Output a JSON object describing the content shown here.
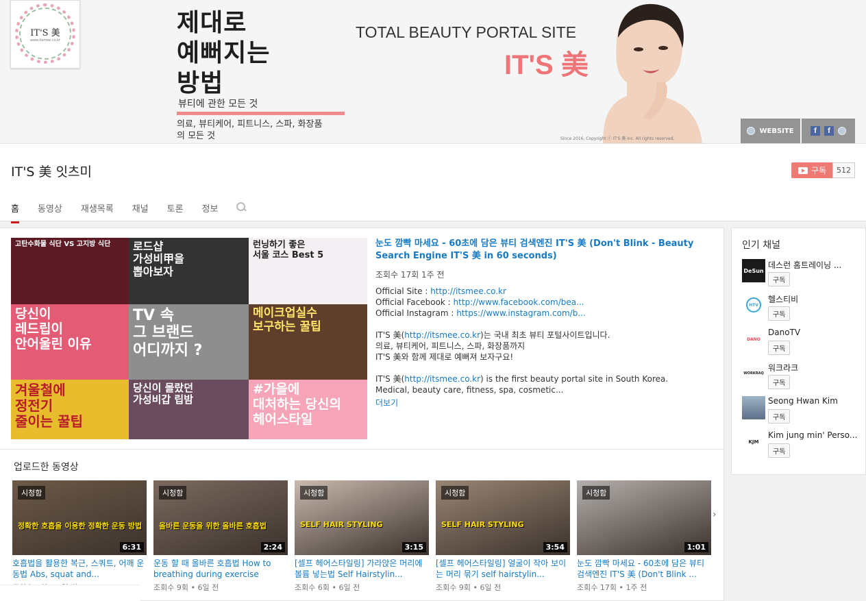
{
  "banner": {
    "logo_text": "IT'S 美",
    "logo_url": "www.itsmee.co.kr",
    "headline": [
      "제대로",
      "예뻐지는",
      "방법"
    ],
    "subline": "뷰티에 관한 모든 것",
    "desc": [
      "의료, 뷰티케어, 피트니스, 스파, 화장품",
      "의 모든 것"
    ],
    "tagline": "TOTAL BEAUTY PORTAL SITE",
    "brand": "IT'S 美",
    "copyright": "Since 2016, Copyright ⓒ IT'S 美 inc. All rights reserved.",
    "website_label": "WEBSITE",
    "fb_glyph": "f"
  },
  "channel": {
    "title": "IT'S 美 잇츠미",
    "subscribe_label": "구독",
    "subscriber_count": "512",
    "tabs": [
      "홈",
      "동영상",
      "재생목록",
      "채널",
      "토론",
      "정보"
    ],
    "active_tab": "홈"
  },
  "featured": {
    "tiles": [
      [
        "고탄수화물 식단 VS 고지방 식단"
      ],
      [
        "로드샵",
        "가성비甲을",
        "뽑아보자"
      ],
      [
        "런닝하기 좋은",
        "서울 코스 Best 5"
      ],
      [
        "당신이",
        "레드립이",
        "안어울린 이유"
      ],
      [
        "TV 속",
        "그 브랜드",
        "어디까지 ?"
      ],
      [
        "메이크업실수",
        "보구하는 꿀팁"
      ],
      [
        "겨울철에",
        "정전기",
        "줄이는 꿀팁"
      ],
      [
        "당신이 몰랐던",
        "가성비갑 립밤"
      ],
      [
        "#가을에",
        "대처하는 당신의",
        "헤어스타일"
      ]
    ],
    "title": "눈도 깜빡 마세요 - 60초에 담은 뷰티 검색엔진 IT'S 美 (Don't Blink - Beauty Search Engine IT'S 美 in 60 seconds)",
    "meta": "조회수 17회  1주 전",
    "site_label": "Official Site : ",
    "site_link": "http://itsmee.co.kr",
    "fb_label": "Official Facebook : ",
    "fb_link": "http://www.facebook.com/bea...",
    "ig_label": "Official Instagram : ",
    "ig_link": "https://www.instagram.com/b...",
    "ko_1a": "IT'S 美(",
    "ko_1_link": "http://itsmee.co.kr",
    "ko_1b": ")는 국내 최초 뷰티 포털사이트입니다.",
    "ko_2": "의료, 뷰티케어, 피트니스, 스파, 화장품까지",
    "ko_3": "IT'S 美와 함께 제대로 예뻐져 보자구요!",
    "en_1a": "IT'S 美(",
    "en_1_link": "http://itsmee.co.kr",
    "en_1b": ") is the first beauty portal site in South Korea.",
    "en_2": "Medical, beauty care, fitness, spa, cosmetic...",
    "more": "더보기"
  },
  "uploads": {
    "heading": "업로드한 동영상",
    "watch_label": "시청함",
    "videos": [
      {
        "title": "호흡법을 활용한 복근, 스쿼트, 어깨 운동법 Abs, squat and...",
        "meta": "조회수 7회 • 5일 전",
        "duration": "6:31",
        "caption": "정확한 호흡을 이용한 정확한 운동 방법",
        "bg": "#6d5a48"
      },
      {
        "title": "운동 할 때 올바른 호흡법 How to breathing during exercise",
        "meta": "조회수 9회 • 6일 전",
        "duration": "2:24",
        "caption": "올바른 운동을 위한 올바른 호흡법",
        "bg": "#7b6a5f"
      },
      {
        "title": "[셀프 헤어스타일링] 가라앉은 머리에 볼륨 넣는법 Self Hairstylin...",
        "meta": "조회수 6회 • 6일 전",
        "duration": "3:15",
        "caption": "SELF HAIR STYLING",
        "bg": "#c9b9ae"
      },
      {
        "title": "[셀프 헤어스타일링] 얼굴이 작아 보이는 머리 묶기 self hairstylin...",
        "meta": "조회수 9회 • 6일 전",
        "duration": "3:54",
        "caption": "SELF HAIR STYLING",
        "bg": "#9a8574"
      },
      {
        "title": "눈도 깜빡 마세요 - 60초에 담은 뷰티 검색엔진 IT'S 美 (Don't Blink ...",
        "meta": "조회수 17회 • 1주 전",
        "duration": "1:01",
        "caption": "",
        "bg": "#b5b0ad"
      }
    ]
  },
  "side": {
    "title": "인기 채널",
    "subscribe_label": "구독",
    "channels": [
      {
        "name": "데스런 홈트레이닝 ...",
        "avatar": "DeSun",
        "color": "#222"
      },
      {
        "name": "헬스티비",
        "avatar": "HTV",
        "color": "#3aa6d8"
      },
      {
        "name": "DanoTV",
        "avatar": "DANO",
        "color": "#e94a5a"
      },
      {
        "name": "워크라크",
        "avatar": "WORKRAQ",
        "color": "#333"
      },
      {
        "name": "Seong Hwan Kim",
        "avatar": "",
        "color": "#7a8aa0"
      },
      {
        "name": "Kim jung min' Perso...",
        "avatar": "KJM",
        "color": "#333"
      }
    ]
  },
  "colors": {
    "accent_link": "#167ac6",
    "subscribe_red": "#e62117",
    "brand_pink": "#ef7478"
  }
}
